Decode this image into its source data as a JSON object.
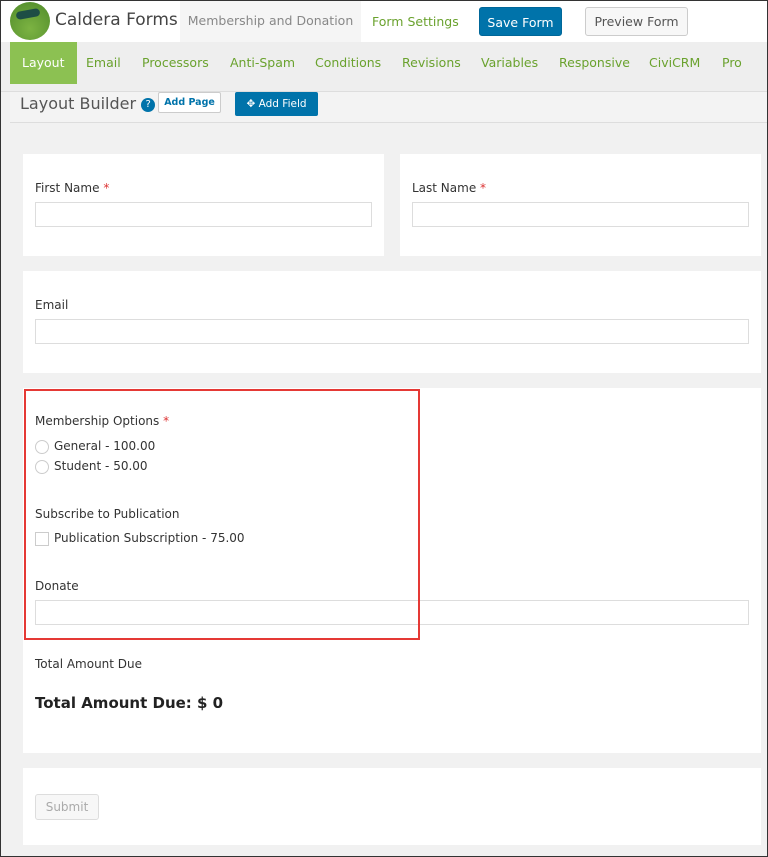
{
  "header": {
    "brand": "Caldera Forms",
    "form_name": "Membership and Donation",
    "form_settings": "Form Settings",
    "save": "Save Form",
    "preview": "Preview Form"
  },
  "tabs": [
    "Layout",
    "Email",
    "Processors",
    "Anti-Spam",
    "Conditions",
    "Revisions",
    "Variables",
    "Responsive",
    "CiviCRM",
    "Pro"
  ],
  "toolbar": {
    "title": "Layout Builder",
    "help": "?",
    "add_page": "Add Page",
    "add_field": "Add Field"
  },
  "fields": {
    "first_name": "First Name",
    "last_name": "Last Name",
    "email": "Email",
    "membership": "Membership Options",
    "membership_options": [
      "General - 100.00",
      "Student - 50.00"
    ],
    "subscribe": "Subscribe to Publication",
    "subscribe_option": "Publication Subscription - 75.00",
    "donate": "Donate",
    "total_label": "Total Amount Due",
    "total_value": "Total Amount Due: $ 0",
    "required": "*",
    "submit": "Submit"
  },
  "colors": {
    "accent": "#8cc152",
    "primary": "#0073aa",
    "highlight": "#e53935"
  }
}
